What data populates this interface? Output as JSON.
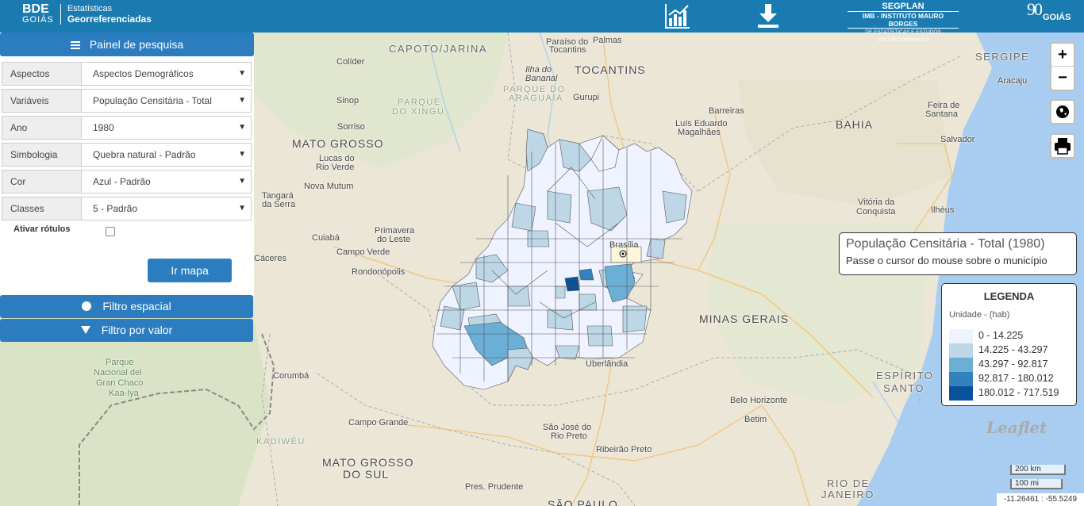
{
  "header": {
    "brand_bde": "BDE",
    "brand_goias": "GOIÁS",
    "brand_sub1": "Estatísticas",
    "brand_sub2": "Georreferenciadas",
    "chart_icon": "bar-chart-icon",
    "download_icon": "download-icon",
    "segplan_title": "SEGPLAN",
    "segplan_line2": "IMB - INSTITUTO MAURO BORGES",
    "segplan_line3": "DE ESTATÍSTICAS E ESTUDOS SOCIOECONÔMICOS",
    "goias_logo_text": "GOIÁS",
    "goias_logo_num": "90"
  },
  "panel": {
    "title": "Painel de pesquisa",
    "fields": [
      {
        "label": "Aspectos",
        "value": "Aspectos Demográficos"
      },
      {
        "label": "Variáveis",
        "value": "População Censitária - Total"
      },
      {
        "label": "Ano",
        "value": "1980"
      },
      {
        "label": "Simbologia",
        "value": "Quebra natural - Padrão"
      },
      {
        "label": "Cor",
        "value": "Azul - Padrão"
      },
      {
        "label": "Classes",
        "value": "5 - Padrão"
      }
    ],
    "labels_toggle": "Ativar rótulos",
    "submit": "Ir mapa",
    "spatial_filter": "Filtro espacial",
    "value_filter": "Filtro por valor"
  },
  "controls": {
    "zoom_in": "+",
    "zoom_out": "−"
  },
  "info": {
    "title": "População Censitária - Total (1980)",
    "hint": "Passe o cursor do mouse sobre o município"
  },
  "legend": {
    "title": "LEGENDA",
    "unit": "Unidade - (hab)",
    "classes": [
      {
        "range": "0 - 14.225",
        "color": "#eff3ff"
      },
      {
        "range": "14.225 - 43.297",
        "color": "#bdd7e7"
      },
      {
        "range": "43.297 - 92.817",
        "color": "#6baed6"
      },
      {
        "range": "92.817 - 180.012",
        "color": "#3182bd"
      },
      {
        "range": "180.012 - 717.519",
        "color": "#08519c"
      }
    ]
  },
  "attribution": "Leaflet",
  "scale": {
    "km": "200 km",
    "mi": "100 mi"
  },
  "coords": "-11.26461 : -55.5249",
  "map_labels": {
    "paraiso": "Paraíso do",
    "tocantins_city": "Tocantins",
    "palmas": "Palmas",
    "capoto": "CAPOTO/JARINA",
    "colider": "Colíder",
    "tocantins": "TOCANTINS",
    "ilha1": "Ilha do",
    "ilha2": "Bananal",
    "pq_araguaia1": "PARQUE DO",
    "pq_araguaia2": "ARAGUAIA",
    "gurupi": "Gurupi",
    "sergipe": "SERGIPE",
    "aracaju": "Aracaju",
    "sinop": "Sinop",
    "pq_xingu1": "PARQUE",
    "pq_xingu2": "DO XINGU",
    "barreiras": "Barreiras",
    "feira1": "Feira de",
    "feira2": "Santana",
    "luis1": "Luís Eduardo",
    "luis2": "Magalhães",
    "bahia": "BAHIA",
    "sorriso": "Sorriso",
    "salvador": "Salvador",
    "mt": "MATO GROSSO",
    "lucas1": "Lucas do",
    "lucas2": "Rio Verde",
    "nova_mutum": "Nova Mutum",
    "tangara1": "Tangará",
    "tangara2": "da Serra",
    "vitoria1": "Vitória da",
    "vitoria2": "Conquista",
    "ilheus": "Ilhéus",
    "primavera1": "Primavera",
    "primavera2": "do Leste",
    "brasilia": "Brasília",
    "cuiaba": "Cuiabá",
    "campo_verde": "Campo Verde",
    "caceres": "Cáceres",
    "rondonopolis": "Rondonópolis",
    "minas": "MINAS GERAIS",
    "parque_nac1": "Parque",
    "parque_nac2": "Nacional del",
    "parque_nac3": "Gran Chaco",
    "parque_nac4": "Kaa-Iya",
    "corumba": "Corumbá",
    "uberlandia": "Uberlândia",
    "es1": "ESPÍRITO",
    "es2": "SANTO",
    "bh": "Belo Horizonte",
    "betim": "Betim",
    "campo_grande": "Campo Grande",
    "cadiweu": "KADIWÉU",
    "sjrp1": "São José do",
    "sjrp2": "Rio Preto",
    "ribeirao": "Ribeirão Preto",
    "ms1": "MATO GROSSO",
    "ms2": "DO SUL",
    "rj1": "RIO DE",
    "rj2": "JANEIRO",
    "prudente": "Pres. Prudente",
    "sao_paulo": "SÃO PAULO"
  }
}
